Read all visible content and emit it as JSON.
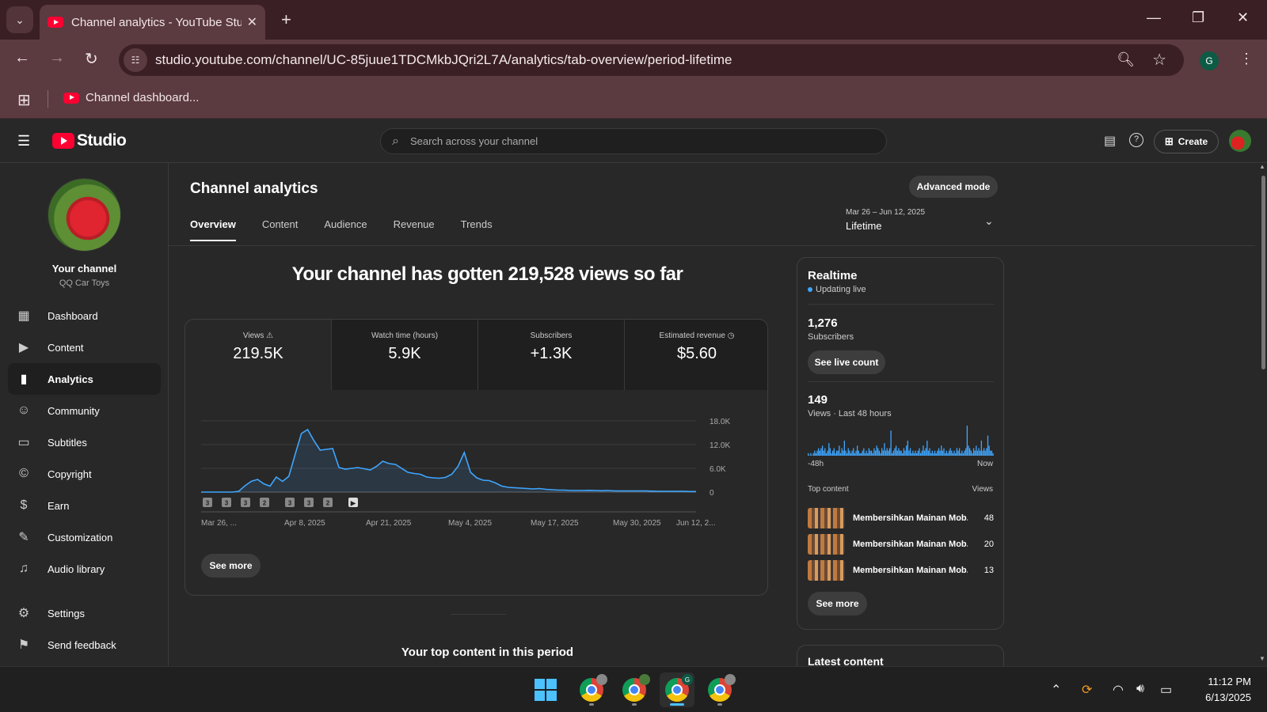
{
  "browser": {
    "tab_title": "Channel analytics - YouTube Studio",
    "url": "studio.youtube.com/channel/UC-85juue1TDCMkbJQri2L7A/analytics/tab-overview/period-lifetime",
    "profile_initial": "G",
    "bookmark_label": "Channel dashboard..."
  },
  "studio": {
    "logo_text": "Studio",
    "search_placeholder": "Search across your channel",
    "create_label": "Create"
  },
  "sidebar": {
    "channel_name": "Your channel",
    "channel_handle": "QQ Car Toys",
    "items": [
      {
        "label": "Dashboard",
        "icon": "dashboard-icon"
      },
      {
        "label": "Content",
        "icon": "content-icon"
      },
      {
        "label": "Analytics",
        "icon": "analytics-icon",
        "active": true
      },
      {
        "label": "Community",
        "icon": "community-icon"
      },
      {
        "label": "Subtitles",
        "icon": "subtitles-icon"
      },
      {
        "label": "Copyright",
        "icon": "copyright-icon"
      },
      {
        "label": "Earn",
        "icon": "earn-icon"
      },
      {
        "label": "Customization",
        "icon": "customization-icon"
      },
      {
        "label": "Audio library",
        "icon": "audio-library-icon"
      }
    ],
    "settings_label": "Settings",
    "feedback_label": "Send feedback"
  },
  "analytics": {
    "title": "Channel analytics",
    "advanced_mode": "Advanced mode",
    "tabs": [
      "Overview",
      "Content",
      "Audience",
      "Revenue",
      "Trends"
    ],
    "period_range": "Mar 26 – Jun 12, 2025",
    "period_label": "Lifetime",
    "headline": "Your channel has gotten 219,528 views so far",
    "metrics": [
      {
        "label": "Views",
        "value": "219.5K"
      },
      {
        "label": "Watch time (hours)",
        "value": "5.9K"
      },
      {
        "label": "Subscribers",
        "value": "+1.3K"
      },
      {
        "label": "Estimated revenue",
        "value": "$5.60"
      }
    ],
    "see_more": "See more",
    "top_content_title": "Your top content in this period"
  },
  "chart_data": {
    "type": "area",
    "x_tick_labels": [
      "Mar 26, ...",
      "Apr 8, 2025",
      "Apr 21, 2025",
      "May 4, 2025",
      "May 17, 2025",
      "May 30, 2025",
      "Jun 12, 2..."
    ],
    "y_tick_labels": [
      "18.0K",
      "12.0K",
      "6.0K",
      "0"
    ],
    "ylim": [
      0,
      18000
    ],
    "values": [
      0,
      0,
      0,
      0,
      0,
      0,
      200,
      1600,
      2700,
      3200,
      2100,
      1500,
      3800,
      2700,
      4000,
      9500,
      14800,
      15800,
      13000,
      10600,
      10800,
      11000,
      6200,
      5800,
      6000,
      6200,
      5900,
      5600,
      6500,
      7800,
      7200,
      7000,
      6000,
      5000,
      4700,
      4500,
      3800,
      3600,
      3500,
      3700,
      4500,
      6500,
      10000,
      5000,
      3600,
      3000,
      2900,
      2300,
      1500,
      1200,
      1100,
      1000,
      900,
      800,
      900,
      700,
      600,
      500,
      500,
      400,
      400,
      400,
      450,
      400,
      350,
      400,
      300,
      300,
      300,
      300,
      300,
      300,
      250,
      200,
      200,
      200,
      200,
      200,
      150,
      150
    ],
    "markers": [
      "3",
      "3",
      "3",
      "2",
      "3",
      "3",
      "2",
      "▶"
    ],
    "color": "#3ea6ff"
  },
  "realtime": {
    "title": "Realtime",
    "status": "Updating live",
    "subscribers_value": "1,276",
    "subscribers_label": "Subscribers",
    "see_live_count": "See live count",
    "views_value": "149",
    "views_label": "Views · Last 48 hours",
    "axis_start": "-48h",
    "axis_end": "Now",
    "bars": [
      1,
      0,
      1,
      0,
      1,
      2,
      1,
      2,
      3,
      2,
      3,
      4,
      2,
      3,
      1,
      2,
      5,
      3,
      1,
      2,
      3,
      1,
      2,
      2,
      4,
      1,
      3,
      2,
      6,
      2,
      1,
      3,
      2,
      1,
      2,
      3,
      1,
      2,
      4,
      2,
      1,
      1,
      2,
      3,
      1,
      2,
      1,
      3,
      2,
      2,
      1,
      3,
      2,
      4,
      3,
      2,
      1,
      3,
      2,
      5,
      2,
      3,
      2,
      3,
      10,
      1,
      2,
      3,
      4,
      2,
      3,
      2,
      2,
      1,
      3,
      2,
      4,
      6,
      2,
      3,
      1,
      2,
      1,
      2,
      1,
      2,
      3,
      1,
      2,
      4,
      2,
      3,
      6,
      2,
      3,
      1,
      2,
      1,
      2,
      1,
      2,
      3,
      2,
      4,
      2,
      3,
      1,
      2,
      1,
      2,
      3,
      2,
      1,
      2,
      1,
      3,
      2,
      3,
      1,
      2,
      1,
      2,
      3,
      12,
      4,
      3,
      2,
      1,
      3,
      2,
      4,
      2,
      3,
      2,
      6,
      2,
      3,
      2,
      3,
      8,
      4,
      2,
      2,
      1
    ],
    "top_content_label": "Top content",
    "top_content_views_label": "Views",
    "top_content": [
      {
        "title": "Membersihkan Mainan Mob...",
        "views": "48"
      },
      {
        "title": "Membersihkan Mainan Mob...",
        "views": "20"
      },
      {
        "title": "Membersihkan Mainan Mob...",
        "views": "13"
      }
    ],
    "see_more": "See more"
  },
  "latest_content_title": "Latest content",
  "taskbar": {
    "time": "11:12 PM",
    "date": "6/13/2025",
    "chrome_badge": "G"
  }
}
